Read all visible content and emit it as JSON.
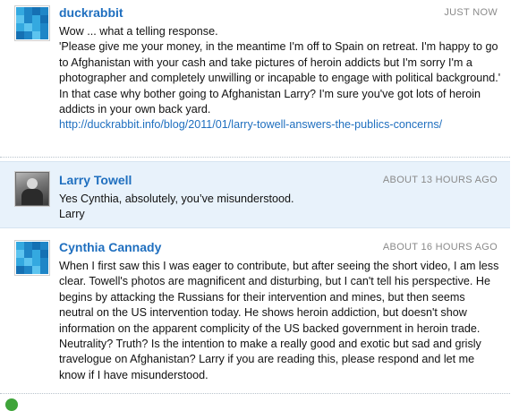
{
  "comments": [
    {
      "author": "duckrabbit",
      "time": "JUST NOW",
      "lines": [
        "Wow ... what a telling response.",
        "'Please give me your money, in the meantime I'm off to Spain on retreat. I'm happy to go to Afghanistan with your cash and take pictures of heroin addicts but I'm sorry I'm a photographer and completely unwilling or incapable to engage with political background.'",
        "In that case why bother going to Afghanistan Larry? I'm sure you've got lots of heroin addicts in your own back yard."
      ],
      "link": "http://duckrabbit.info/blog/2011/01/larry-towell-answers-the-publics-concerns/",
      "avatar_icon": "blue-mosaic-avatar"
    },
    {
      "author": "Larry Towell",
      "time": "ABOUT 13 HOURS AGO",
      "lines": [
        "Yes Cynthia, absolutely, you’ve misunderstood.",
        "Larry"
      ],
      "avatar_icon": "photo-avatar"
    },
    {
      "author": "Cynthia Cannady",
      "time": "ABOUT 16 HOURS AGO",
      "lines": [
        "When I first saw this I was eager to contribute, but after seeing the short video, I am less clear. Towell's photos are magnificent and disturbing, but I can't tell his perspective. He begins by attacking the Russians for their intervention and mines, but then seems neutral on the US intervention today. He shows heroin addiction, but doesn't show information on the apparent complicity of the US backed government in heroin trade. Neutrality? Truth? Is the intention to make a really good and exotic but sad and grisly travelogue on Afghanistan? Larry if you are reading this, please respond and let me know if I have misunderstood."
      ],
      "avatar_icon": "blue-mosaic-avatar"
    }
  ],
  "colors": {
    "author_link": "#1f6fbf",
    "highlight_bg": "#e8f2fb",
    "timestamp": "#8a8a8a"
  }
}
